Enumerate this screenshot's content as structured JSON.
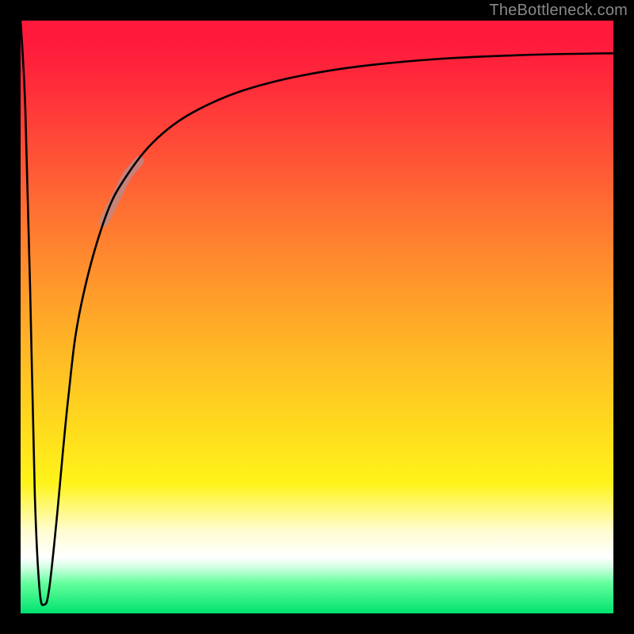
{
  "watermark": {
    "text": "TheBottleneck.com"
  },
  "chart_data": {
    "type": "line",
    "title": "",
    "xlabel": "",
    "ylabel": "",
    "xlim": [
      0,
      100
    ],
    "ylim": [
      0,
      100
    ],
    "grid": false,
    "legend": false,
    "background_gradient": [
      {
        "stop": 0.0,
        "color": "#ff1a3c"
      },
      {
        "stop": 0.5,
        "color": "#ffa52a"
      },
      {
        "stop": 0.8,
        "color": "#fff41a"
      },
      {
        "stop": 0.9,
        "color": "#ffffff"
      },
      {
        "stop": 1.0,
        "color": "#00e26e"
      }
    ],
    "series": [
      {
        "name": "bottleneck-curve",
        "x": [
          0.0,
          0.8,
          1.6,
          2.4,
          3.2,
          4.0,
          4.8,
          6.0,
          8.0,
          10.0,
          14.0,
          18.0,
          24.0,
          32.0,
          42.0,
          55.0,
          70.0,
          85.0,
          100.0
        ],
        "y": [
          100.0,
          85.0,
          55.0,
          20.0,
          4.0,
          1.5,
          4.0,
          15.0,
          36.0,
          51.0,
          66.0,
          74.0,
          81.0,
          86.0,
          89.5,
          92.0,
          93.5,
          94.2,
          94.5
        ]
      }
    ],
    "highlight_segment": {
      "series": "bottleneck-curve",
      "x_start": 14.0,
      "x_end": 20.0
    },
    "notes": "y-axis inverted visually (higher y plotted nearer top of the gradient area); values are approximate readings without visible axis ticks"
  }
}
